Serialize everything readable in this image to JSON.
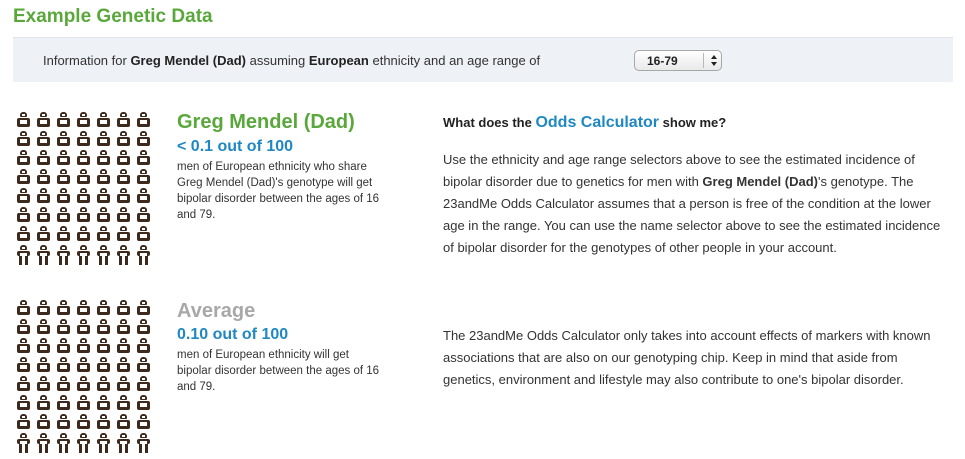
{
  "page": {
    "title": "Example Genetic Data"
  },
  "info_bar": {
    "prefix": "Information for ",
    "person": "Greg Mendel (Dad)",
    "middle": " assuming ",
    "ethnicity": "European",
    "suffix": " ethnicity and an age range of",
    "age_select": {
      "selected": "16-79"
    }
  },
  "results": [
    {
      "name": "Greg Mendel (Dad)",
      "value": "< 0.1 out of 100",
      "description": "men of European ethnicity who share Greg Mendel (Dad)'s genotype will get bipolar disorder between the ages of 16 and 79.",
      "name_color": "#5aa83b"
    },
    {
      "name": "Average",
      "value": "0.10 out of 100",
      "description": "men of European ethnicity will get bipolar disorder between the ages of 16 and 79.",
      "name_color": "#a8a8a8"
    }
  ],
  "explainer": {
    "question_prefix": "What does the ",
    "question_link": "Odds Calculator",
    "question_suffix": " show me?",
    "p1_a": "Use the ethnicity and age range selectors above to see the estimated incidence of bipolar disorder due to genetics for men with ",
    "p1_name": "Greg Mendel (Dad)",
    "p1_b": "'s genotype. The 23andMe Odds Calculator assumes that a person is free of the condition at the lower age in the range. You can use the name selector above to see the estimated incidence of bipolar disorder for the genotypes of other people in your account.",
    "p2": "The 23andMe Odds Calculator only takes into account effects of markers with known associations that are also on our genotyping chip. Keep in mind that aside from genetics, environment and lifestyle may also contribute to one's bipolar disorder."
  },
  "colors": {
    "green": "#5aa83b",
    "blue": "#1f88c4",
    "gray": "#a8a8a8",
    "figure": "#3d2a1c"
  },
  "icons": {
    "people": "person-figure-icon",
    "select_arrows": "up-down-arrows-icon"
  }
}
